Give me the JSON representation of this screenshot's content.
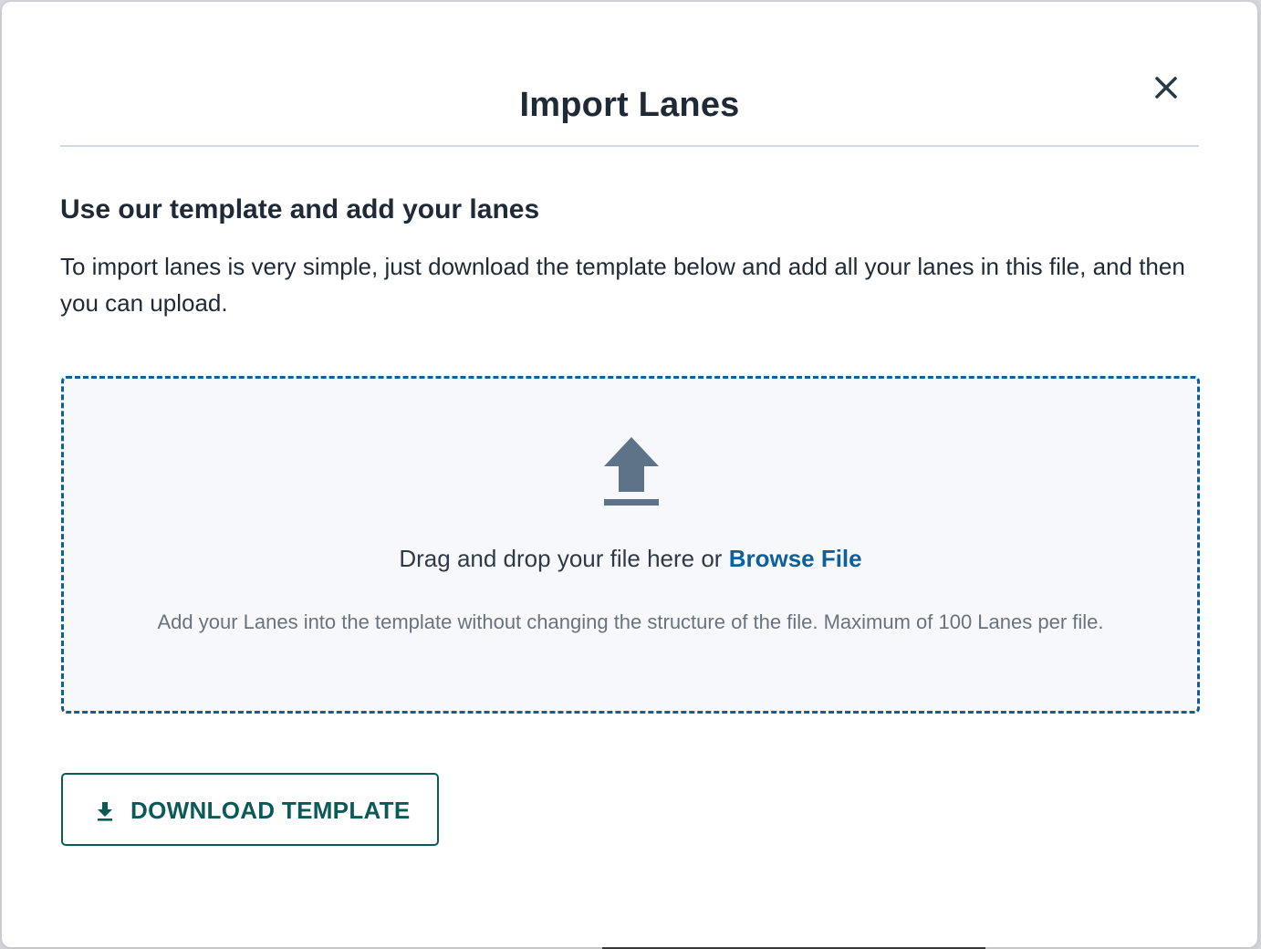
{
  "modal": {
    "title": "Import Lanes",
    "close_icon": "close-icon"
  },
  "section": {
    "heading": "Use our template and add your lanes",
    "description": "To import lanes is very simple, just download the template below and add all your lanes in this file, and then you can upload."
  },
  "dropzone": {
    "icon": "upload-icon",
    "prompt": "Drag and drop your file here or ",
    "browse_link": "Browse File",
    "note": "Add your Lanes into the template without changing the structure of the file. Maximum of 100 Lanes per file."
  },
  "download_button": {
    "icon": "download-icon",
    "label": "DOWNLOAD TEMPLATE"
  },
  "colors": {
    "heading_text": "#1f2a36",
    "link": "#0f5f98",
    "dropzone_border": "#0f5f98",
    "button_accent": "#0b5a57",
    "icon_gray": "#5c7388"
  }
}
